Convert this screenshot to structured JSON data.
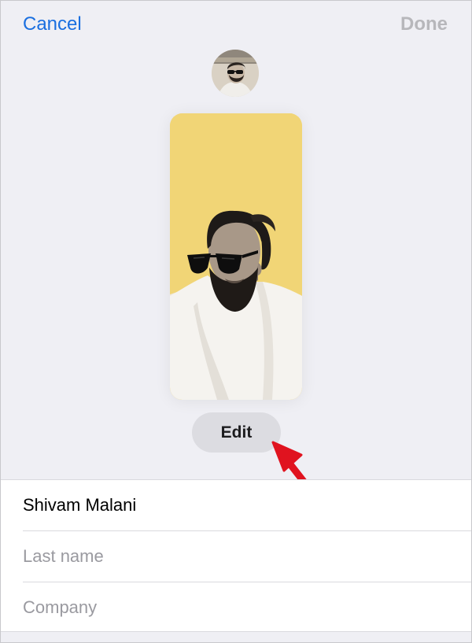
{
  "nav": {
    "cancel_label": "Cancel",
    "done_label": "Done"
  },
  "poster": {
    "background_color": "#f1d576",
    "edit_label": "Edit"
  },
  "form": {
    "first_name_value": "Shivam Malani",
    "last_name_placeholder": "Last name",
    "company_placeholder": "Company"
  },
  "colors": {
    "accent": "#1a6fe0",
    "disabled": "#b7b7bb",
    "annotation_arrow": "#e0131f"
  },
  "icons": {
    "avatar": "contact-photo",
    "poster_photo": "person-photo",
    "annotation": "red-arrow"
  }
}
